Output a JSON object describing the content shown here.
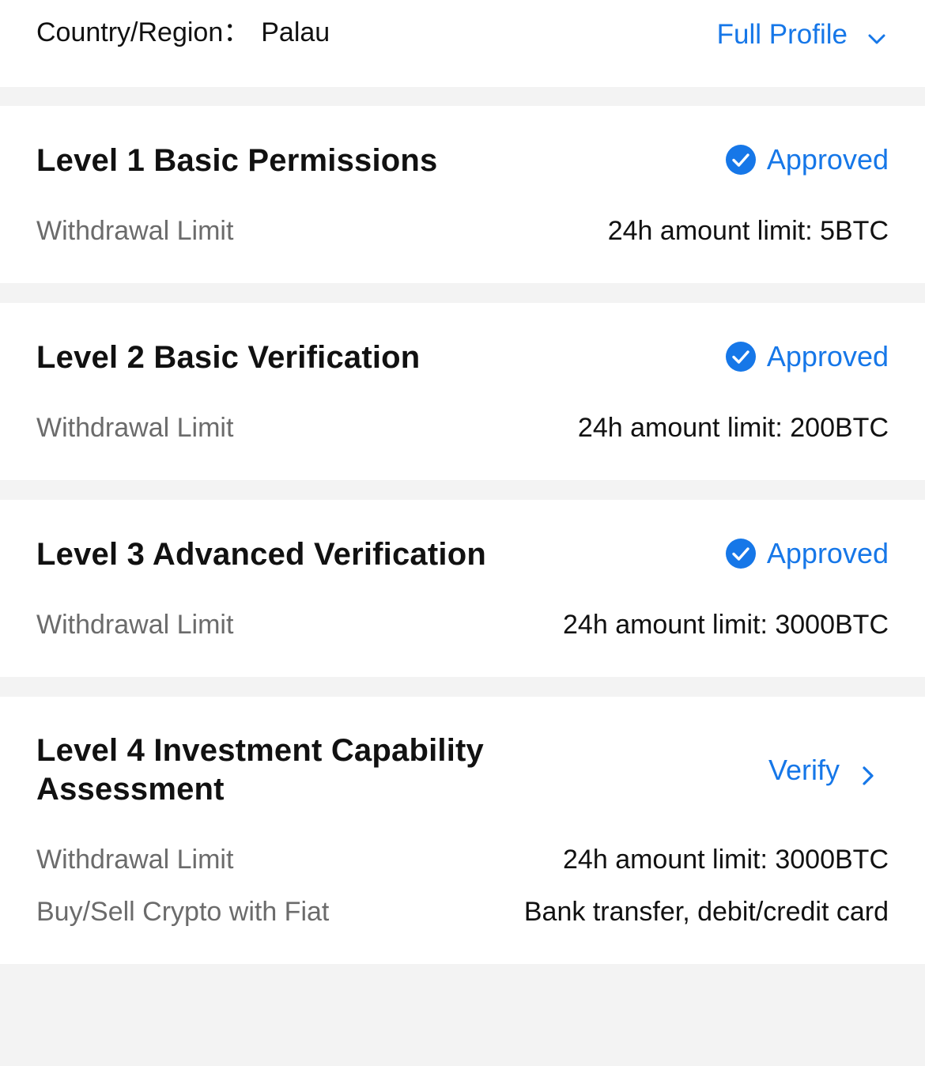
{
  "header": {
    "country_label": "Country/Region：",
    "country_value": "Palau",
    "full_profile_label": "Full Profile"
  },
  "levels": [
    {
      "title": "Level 1 Basic Permissions",
      "status": "Approved",
      "rows": [
        {
          "label": "Withdrawal Limit",
          "value": "24h amount limit: 5BTC"
        }
      ]
    },
    {
      "title": "Level 2 Basic Verification",
      "status": "Approved",
      "rows": [
        {
          "label": "Withdrawal Limit",
          "value": "24h amount limit: 200BTC"
        }
      ]
    },
    {
      "title": "Level 3 Advanced Verification",
      "status": "Approved",
      "rows": [
        {
          "label": "Withdrawal Limit",
          "value": "24h amount limit: 3000BTC"
        }
      ]
    },
    {
      "title_line1": "Level 4 Investment Capability",
      "title_line2": "Assessment",
      "action": "Verify",
      "rows": [
        {
          "label": "Withdrawal Limit",
          "value": "24h amount limit: 3000BTC"
        },
        {
          "label": "Buy/Sell Crypto with Fiat",
          "value": "Bank transfer, debit/credit card"
        }
      ]
    }
  ],
  "colors": {
    "accent": "#1677e8",
    "background": "#f3f3f3",
    "card": "#ffffff",
    "muted_text": "#6b6b6b"
  }
}
